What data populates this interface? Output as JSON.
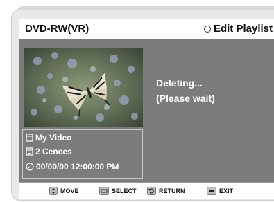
{
  "header": {
    "disc_type": "DVD-RW(VR)",
    "menu_title": "Edit Playlist"
  },
  "info": {
    "title": "My Video",
    "scenes": "2 Cences",
    "datetime": "00/00/00 12:00:00  PM"
  },
  "status": {
    "line1": "Deleting...",
    "line2": "(Please wait)"
  },
  "footer": {
    "move": "MOVE",
    "select": "SELECT",
    "return": "RETURN",
    "exit": "EXIT"
  }
}
